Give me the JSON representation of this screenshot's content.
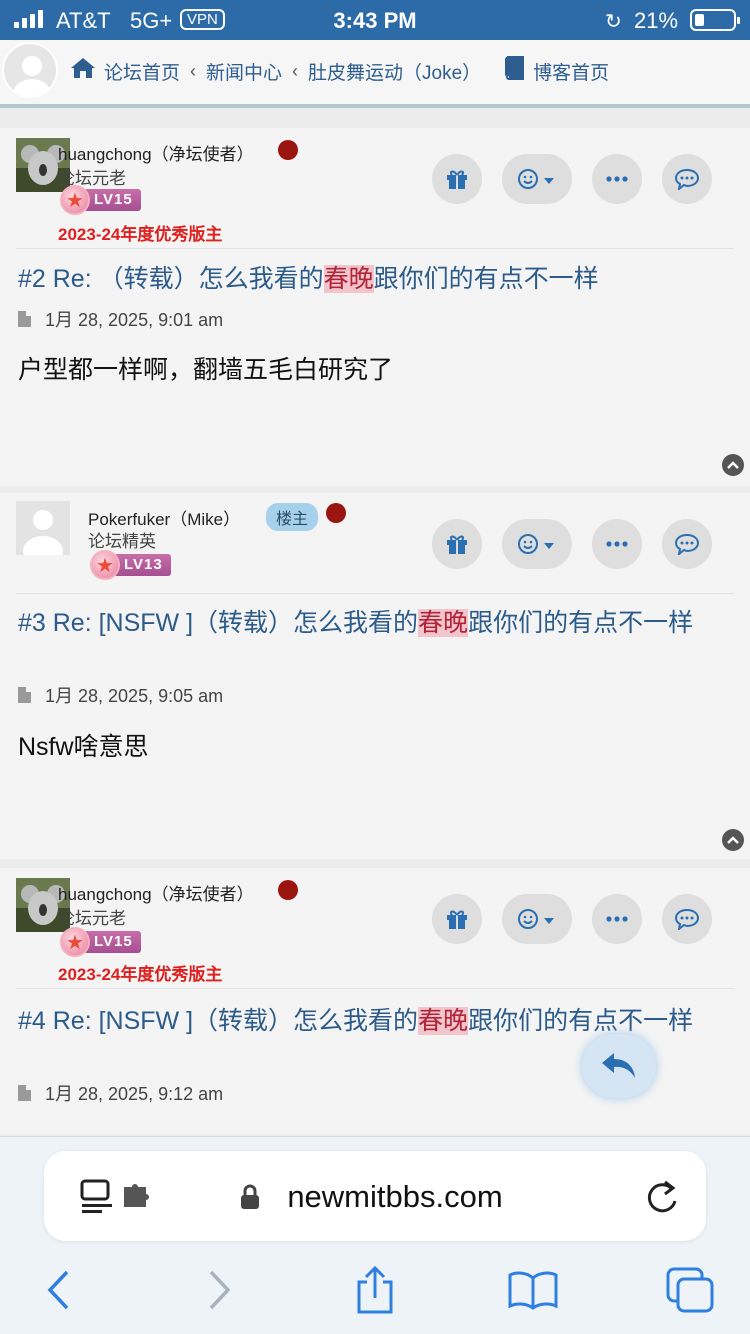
{
  "status_bar": {
    "carrier": "AT&T",
    "network": "5G+",
    "vpn": "VPN",
    "time": "3:43 PM",
    "battery": "21%"
  },
  "nav": {
    "crumbs": [
      "论坛首页",
      "新闻中心",
      "肚皮舞运动（Joke）"
    ],
    "blog": "博客首页"
  },
  "posts": [
    {
      "username": "huangchong（净坛使者）",
      "rank": "论坛元老",
      "level": "LV15",
      "award": "2023-24年度优秀版主",
      "title_prefix": "#2 Re: （转载）怎么我看的",
      "title_highlight": "春晚",
      "title_suffix": "跟你们的有点不一样",
      "date": "1月 28, 2025, 9:01 am",
      "body": "户型都一样啊，翻墙五毛白研究了"
    },
    {
      "username": "Pokerfuker（Mike）",
      "badge": "楼主",
      "rank": "论坛精英",
      "level": "LV13",
      "title_prefix": "#3 Re: [NSFW ]（转载）怎么我看的",
      "title_highlight": "春晚",
      "title_suffix": "跟你们的有点不一样",
      "date": "1月 28, 2025, 9:05 am",
      "body": "Nsfw啥意思"
    },
    {
      "username": "huangchong（净坛使者）",
      "rank": "论坛元老",
      "level": "LV15",
      "award": "2023-24年度优秀版主",
      "title_prefix": "#4 Re: [NSFW ]（转载）怎么我看的",
      "title_highlight": "春晚",
      "title_suffix": "跟你们的有点不一样",
      "date": "1月 28, 2025, 9:12 am"
    }
  ],
  "browser": {
    "url": "newmitbbs.com"
  },
  "colors": {
    "status_bar": "#2d6aa8",
    "link": "#2c5b8a",
    "highlight_bg": "#f2c5cc",
    "award": "#e01f1f",
    "ios_blue": "#2f7fe0"
  }
}
